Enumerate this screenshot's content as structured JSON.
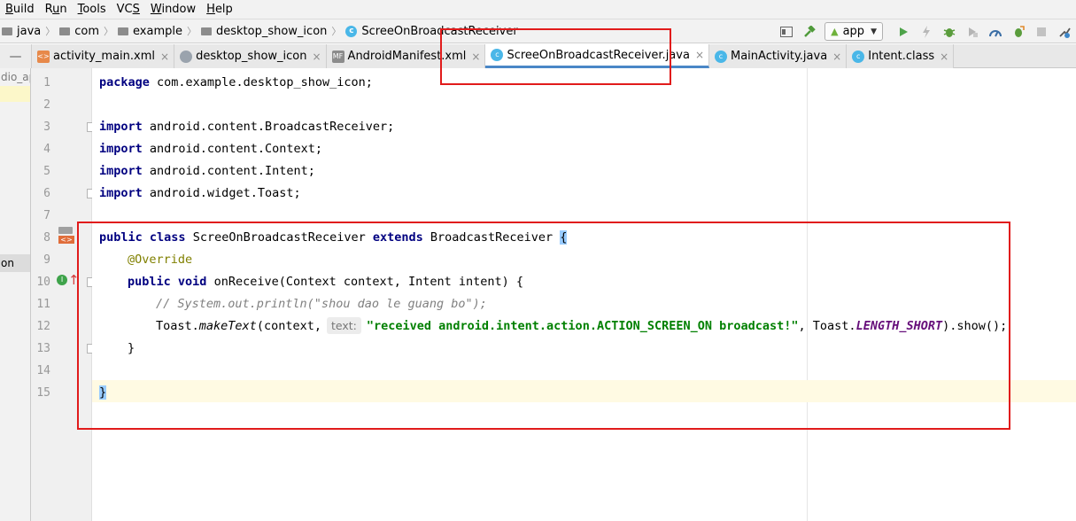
{
  "menu": [
    "Build",
    "Run",
    "Tools",
    "VCS",
    "Window",
    "Help"
  ],
  "menu_underline": [
    "B",
    "u",
    "T",
    "S",
    "W",
    "H"
  ],
  "breadcrumb": {
    "items": [
      "java",
      "com",
      "example",
      "desktop_show_icon",
      "ScreeOnBroadcastReceiver"
    ]
  },
  "toolbar": {
    "app_config": "app",
    "icons": [
      "layout-icon",
      "hammer-icon",
      "run-icon",
      "apply-changes-icon",
      "debug-icon",
      "coverage-icon",
      "profile-icon",
      "attach-debugger-icon",
      "stop-icon",
      "sync-icon"
    ]
  },
  "tabs": [
    {
      "label": "activity_main.xml",
      "icon": "xml",
      "active": false
    },
    {
      "label": "desktop_show_icon",
      "icon": "img",
      "active": false
    },
    {
      "label": "AndroidManifest.xml",
      "icon": "mf",
      "active": false
    },
    {
      "label": "ScreeOnBroadcastReceiver.java",
      "icon": "cls",
      "active": true
    },
    {
      "label": "MainActivity.java",
      "icon": "cls",
      "active": false
    },
    {
      "label": "Intent.class",
      "icon": "clsc",
      "active": false
    }
  ],
  "sidepanel": {
    "top_text": "dio_ap",
    "mid_text": "on"
  },
  "line_numbers": [
    "1",
    "2",
    "3",
    "4",
    "5",
    "6",
    "7",
    "8",
    "9",
    "10",
    "11",
    "12",
    "13",
    "14",
    "15"
  ],
  "code": {
    "l1_kw": "package",
    "l1_rest": " com.example.desktop_show_icon;",
    "l3_kw": "import",
    "l3_rest": " android.content.BroadcastReceiver;",
    "l4_kw": "import",
    "l4_rest": " android.content.Context;",
    "l5_kw": "import",
    "l5_rest": " android.content.Intent;",
    "l6_kw": "import",
    "l6_rest": " android.widget.Toast;",
    "l8_kw1": "public",
    "l8_kw2": "class",
    "l8_name": " ScreeOnBroadcastReceiver ",
    "l8_kw3": "extends",
    "l8_rest": " BroadcastReceiver ",
    "l8_brace": "{",
    "l9_ann": "@Override",
    "l10_kw1": "public",
    "l10_kw2": "void",
    "l10_rest": " onReceive(Context context, Intent intent) {",
    "l11_comment": "// System.out.println(\"shou dao le guang bo\");",
    "l12_pre": "Toast.",
    "l12_method": "makeText",
    "l12_args": "(context,",
    "l12_hint": "text:",
    "l12_str": "\"received android.intent.action.ACTION_SCREEN_ON broadcast!\"",
    "l12_mid": ", Toast.",
    "l12_const": "LENGTH_SHORT",
    "l12_end": ").show();",
    "l13": "}",
    "l15": "}"
  }
}
